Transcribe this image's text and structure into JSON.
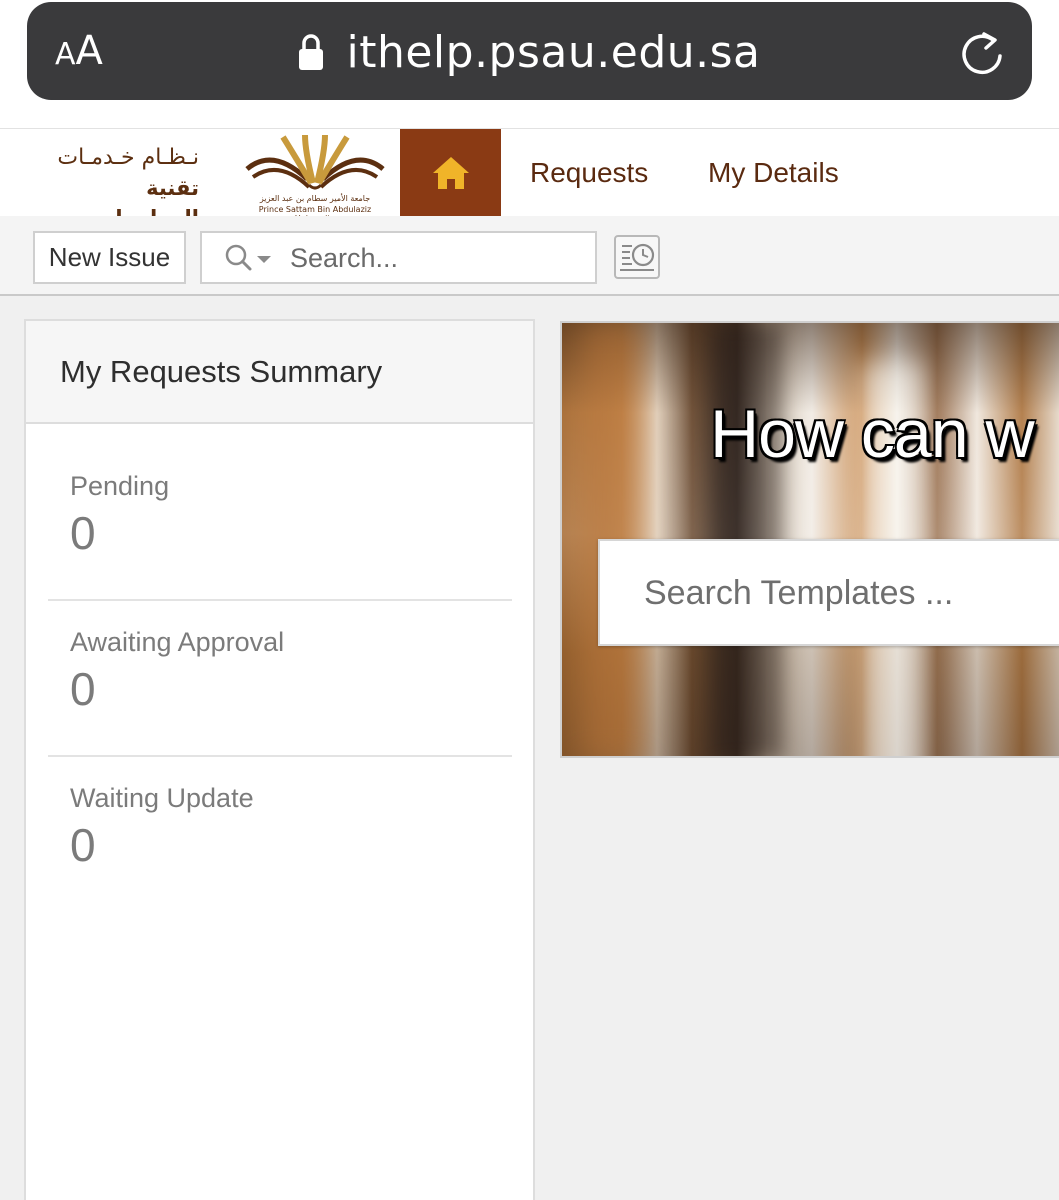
{
  "browser": {
    "text_size_label_small": "A",
    "text_size_label_big": "A",
    "url": "ithelp.psau.edu.sa"
  },
  "header": {
    "logo_arabic_line1": "نـظـام خـدمـات",
    "logo_arabic_line2": "تقنية المعلومات",
    "university_arabic": "جامعة الأمير سطام بن عبد العزيز",
    "university_english": "Prince Sattam Bin Abdulaziz University",
    "nav": {
      "requests": "Requests",
      "my_details": "My Details"
    },
    "colors": {
      "home_bg": "#8a3a14",
      "home_icon": "#f0b429",
      "nav_text": "#5a2a10"
    }
  },
  "toolbar": {
    "new_issue_label": "New Issue",
    "search_placeholder": "Search...",
    "history_icon": "history-clock-icon"
  },
  "summary": {
    "title": "My Requests Summary",
    "stats": [
      {
        "label": "Pending",
        "value": "0"
      },
      {
        "label": "Awaiting Approval",
        "value": "0"
      },
      {
        "label": "Waiting Update",
        "value": "0"
      }
    ]
  },
  "hero": {
    "title": "How can w",
    "search_placeholder": "Search Templates ..."
  }
}
